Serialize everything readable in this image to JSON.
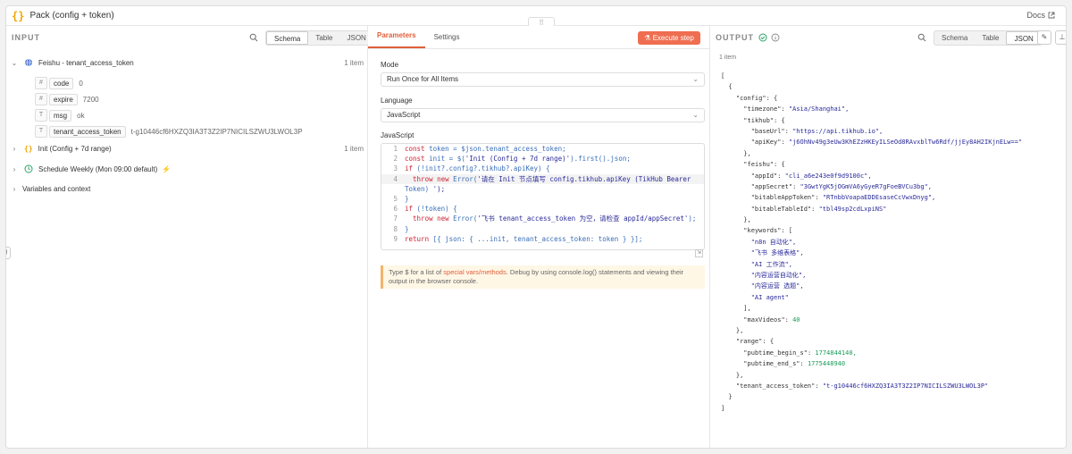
{
  "header": {
    "node_icon": "{}",
    "title": "Pack (config + token)",
    "docs_label": "Docs",
    "drag_handle": "⠿"
  },
  "input": {
    "title": "INPUT",
    "views": [
      "Schema",
      "Table",
      "JSON"
    ],
    "nodes": [
      {
        "label": "Feishu - tenant_access_token",
        "count": "1 item",
        "expanded": true,
        "icon": "globe-icon"
      },
      {
        "label": "Init (Config + 7d range)",
        "count": "1 item",
        "expanded": false,
        "icon": "braces-icon"
      },
      {
        "label": "Schedule Weekly (Mon 09:00 default)",
        "count": "",
        "expanded": false,
        "icon": "clock-icon",
        "marker": "⚡"
      }
    ],
    "fields": [
      {
        "type": "#",
        "name": "code",
        "value": "0"
      },
      {
        "type": "#",
        "name": "expire",
        "value": "7200"
      },
      {
        "type": "T",
        "name": "msg",
        "value": "ok"
      },
      {
        "type": "T",
        "name": "tenant_access_token",
        "value": "t-g10446cf6HXZQ3IA3T3Z2IP7NICILSZWU3LWOL3P"
      }
    ],
    "vars_label": "Variables and context"
  },
  "params": {
    "tabs": [
      "Parameters",
      "Settings"
    ],
    "execute_label": "Execute step",
    "mode_label": "Mode",
    "mode_value": "Run Once for All Items",
    "language_label": "Language",
    "language_value": "JavaScript",
    "code_label": "JavaScript",
    "hint_pre": "Type $ for a list of ",
    "hint_link": "special vars/methods",
    "hint_post": ". Debug by using console.log() statements and viewing their output in the browser console."
  },
  "code_lines": [
    "const token = $json.tenant_access_token;",
    "const init = $('Init (Config + 7d range)').first().json;",
    "if (!init?.config?.tikhub?.apiKey) {",
    "  throw new Error('请在 Init 节点填写 config.tikhub.apiKey (TikHub Bearer",
    "Token) ');",
    "}",
    "if (!token) {",
    "  throw new Error('飞书 tenant_access_token 为空，请检查 appId/appSecret');",
    "}",
    "return [{ json: { ...init, tenant_access_token: token } }];"
  ],
  "line_numbers": [
    "1",
    "2",
    "3",
    "4",
    "",
    "5",
    "6",
    "7",
    "8",
    "9"
  ],
  "output": {
    "title": "OUTPUT",
    "views": [
      "Schema",
      "Table",
      "JSON"
    ],
    "count": "1 item",
    "lines": [
      "[",
      "  {",
      "    \"config\": {",
      "      \"timezone\": \"Asia/Shanghai\",",
      "      \"tikhub\": {",
      "        \"baseUrl\": \"https://api.tikhub.io\",",
      "        \"apiKey\": \"j6OhNv49g3eUw3KhEZzHKEyILSeOd8RAvxblTw6Rdf/jjEy8AH2IKjnELw==\"",
      "      },",
      "      \"feishu\": {",
      "        \"appId\": \"cli_a6e243e0f9d9100c\",",
      "        \"appSecret\": \"3GwtYgK5jOGmVA6yGyeR7gFoeBVCu3bg\",",
      "        \"bitableAppToken\": \"RTnbbVoapaEDDEsaseCcVwxDnyg\",",
      "        \"bitableTableId\": \"tbl49sp2cdLxpiNS\"",
      "      },",
      "      \"keywords\": [",
      "        \"n8n 自动化\",",
      "        \"飞书 多维表格\",",
      "        \"AI 工作流\",",
      "        \"内容运营自动化\",",
      "        \"内容运营 选题\",",
      "        \"AI agent\"",
      "      ],",
      "      \"maxVideos\": 40",
      "    },",
      "    \"range\": {",
      "      \"pubtime_begin_s\": 1774844140,",
      "      \"pubtime_end_s\": 1775448940",
      "    },",
      "    \"tenant_access_token\": \"t-g10446cf6HXZQ3IA3T3Z2IP7NICILSZWU3LWOL3P\"",
      "  }",
      "]"
    ]
  }
}
